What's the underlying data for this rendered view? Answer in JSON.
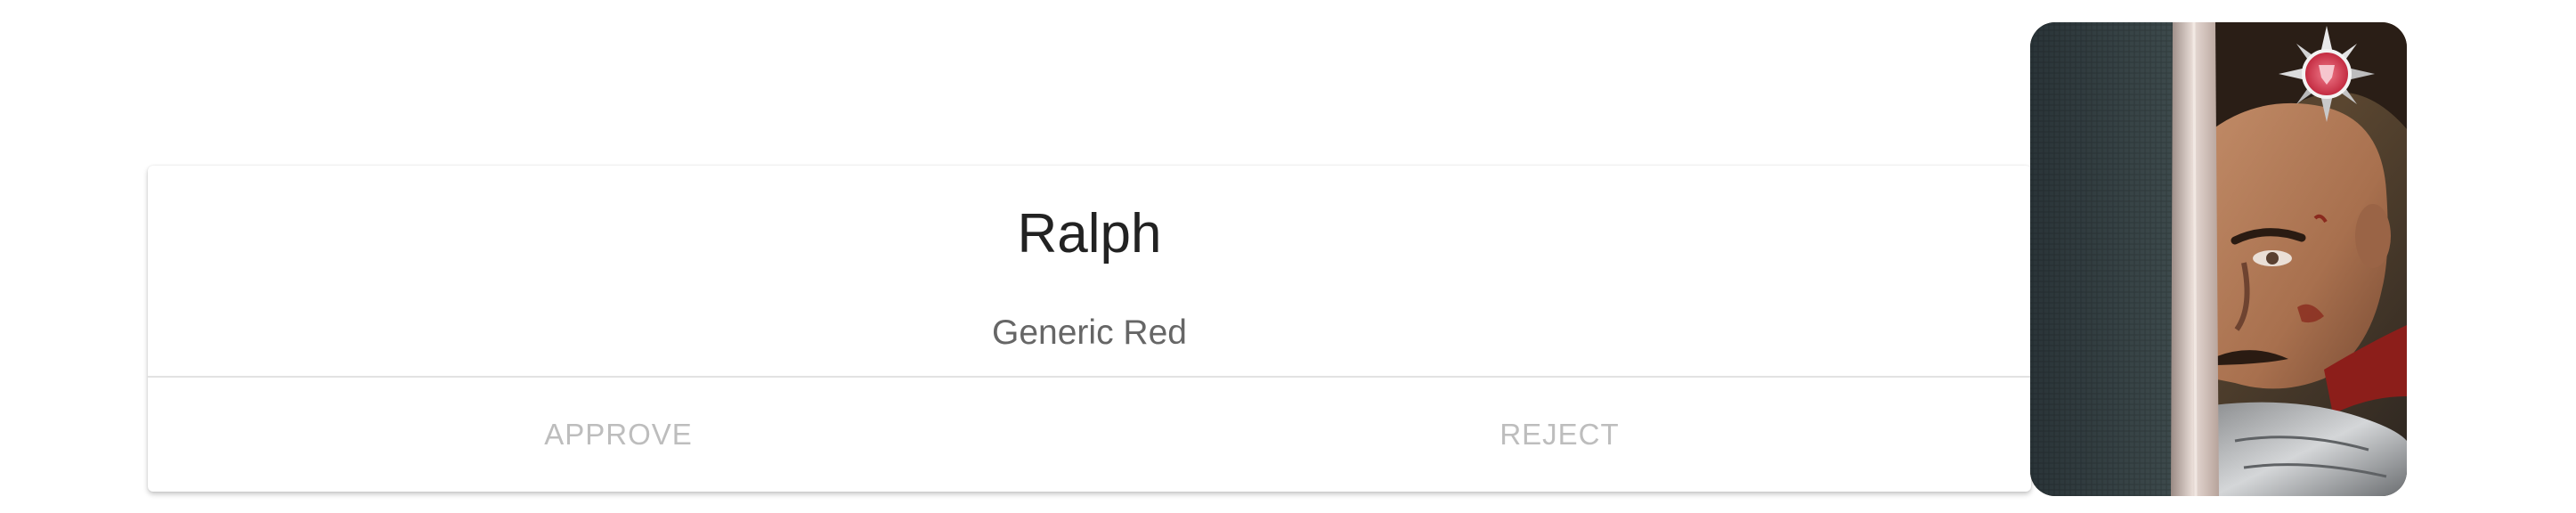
{
  "card": {
    "title": "Ralph",
    "subtitle": "Generic Red",
    "actions": {
      "approve_label": "APPROVE",
      "reject_label": "REJECT"
    }
  },
  "portrait": {
    "image": "warrior-portrait",
    "emblem_icon": "compass-emblem-icon"
  },
  "colors": {
    "title_text": "#222222",
    "subtitle_text": "#666666",
    "action_text": "#bdbdbd",
    "divider": "#e2e2e2",
    "emblem_red": "#d8344a"
  }
}
